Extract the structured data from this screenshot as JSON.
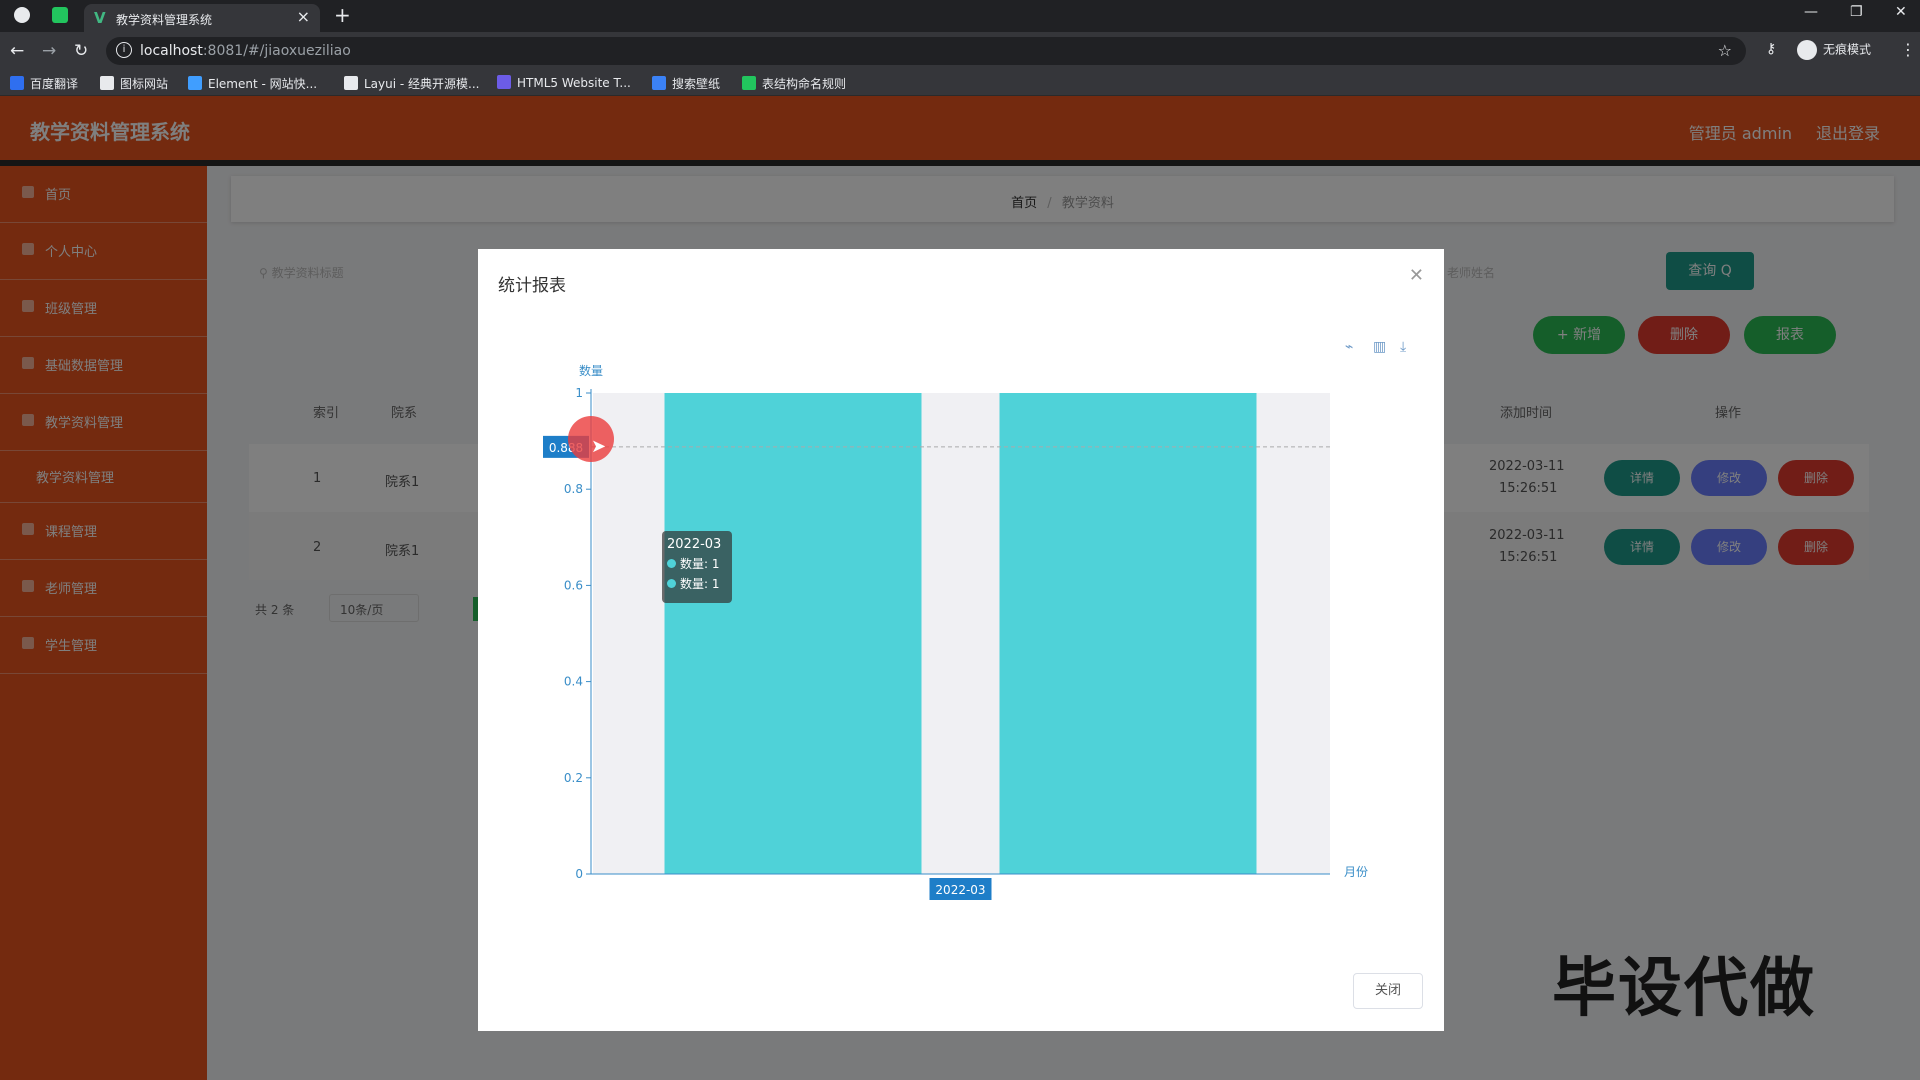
{
  "browser": {
    "tab_title": "教学资料管理系统",
    "url_host": "localhost",
    "url_rest": ":8081/#/jiaoxueziliao",
    "incognito_label": "无痕模式",
    "bookmarks": [
      {
        "label": "百度翻译",
        "color": "#2f6ff0"
      },
      {
        "label": "图标网站",
        "color": "#e8eaed"
      },
      {
        "label": "Element - 网站快...",
        "color": "#409eff"
      },
      {
        "label": "Layui - 经典开源模...",
        "color": "#e8eaed"
      },
      {
        "label": "HTML5 Website T...",
        "color": "#6c5ce7"
      },
      {
        "label": "搜索壁纸",
        "color": "#3b82f6"
      },
      {
        "label": "表结构命名规则",
        "color": "#22c55e"
      }
    ]
  },
  "app": {
    "title": "教学资料管理系统",
    "user": "管理员 admin",
    "logout": "退出登录",
    "brand_color": "#e8541e"
  },
  "sidebar": {
    "items": [
      {
        "label": "首页"
      },
      {
        "label": "个人中心"
      },
      {
        "label": "班级管理"
      },
      {
        "label": "基础数据管理"
      },
      {
        "label": "教学资料管理"
      }
    ],
    "sub_item": "教学资料管理",
    "items_after": [
      {
        "label": "课程管理"
      },
      {
        "label": "老师管理"
      },
      {
        "label": "学生管理"
      }
    ]
  },
  "main": {
    "breadcrumb_home": "首页",
    "breadcrumb_sep": "/",
    "breadcrumb_current": "教学资料",
    "search_placeholder": "教学资料标题",
    "search2_placeholder": "老师姓名",
    "query_label": "查询 Q",
    "add_label": "+ 新增",
    "delete_label": "删除",
    "report_label": "报表",
    "columns": {
      "index": "索引",
      "dept": "院系",
      "added": "添加时间",
      "ops": "操作"
    },
    "rows": [
      {
        "index": "1",
        "dept": "院系1",
        "date": "2022-03-11",
        "time": "15:26:51"
      },
      {
        "index": "2",
        "dept": "院系1",
        "date": "2022-03-11",
        "time": "15:26:51"
      }
    ],
    "op_detail": "详情",
    "op_edit": "修改",
    "op_delete": "删除",
    "pager_total": "共 2 条",
    "pager_size": "10条/页"
  },
  "modal": {
    "title": "统计报表",
    "close_label": "关闭"
  },
  "chart_data": {
    "type": "bar",
    "ylabel": "数量",
    "xlabel": "月份",
    "categories": [
      "2022-03"
    ],
    "series": [
      {
        "name": "数量",
        "values": [
          1
        ]
      },
      {
        "name": "数量",
        "values": [
          1
        ]
      }
    ],
    "ylim": [
      0,
      1
    ],
    "yticks": [
      "0",
      "0.2",
      "0.4",
      "0.6",
      "0.8",
      "1"
    ],
    "bar_color": "#4fd2d8",
    "axis_pointer_y": "0.888",
    "axis_pointer_x": "2022-03",
    "tooltip": {
      "title": "2022-03",
      "lines": [
        "数量: 1",
        "数量: 1"
      ]
    }
  },
  "watermark": "毕设代做"
}
